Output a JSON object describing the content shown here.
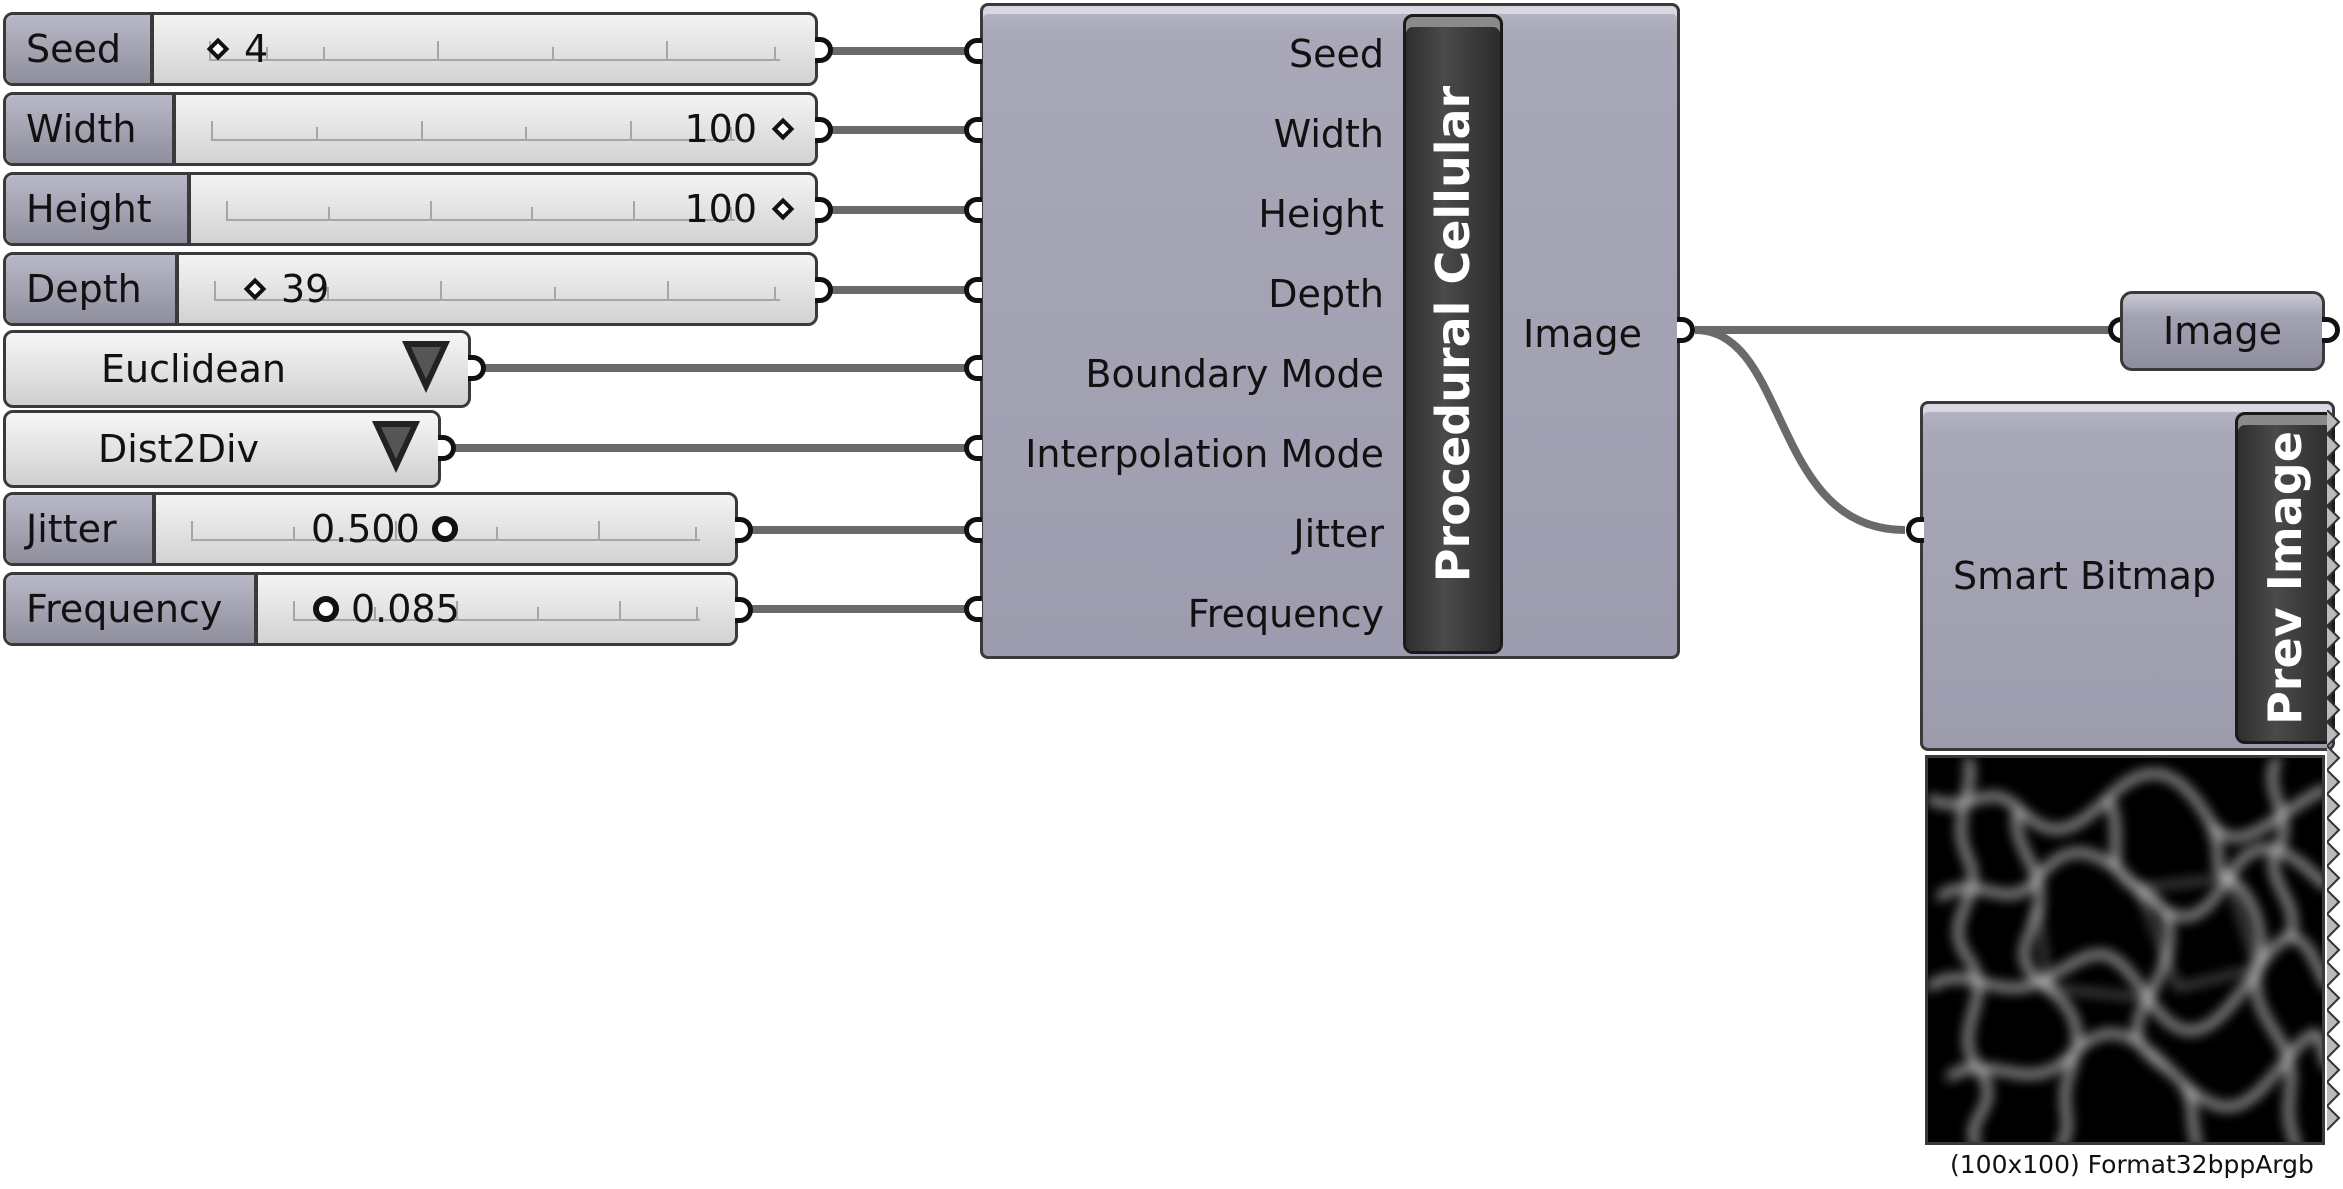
{
  "sliders": [
    {
      "label": "Seed",
      "value": "4"
    },
    {
      "label": "Width",
      "value": "100"
    },
    {
      "label": "Height",
      "value": "100"
    },
    {
      "label": "Depth",
      "value": "39"
    },
    {
      "label": "Jitter",
      "value": "0.500"
    },
    {
      "label": "Frequency",
      "value": "0.085"
    }
  ],
  "value_lists": [
    {
      "value": "Euclidean"
    },
    {
      "value": "Dist2Div"
    }
  ],
  "procedural_cellular": {
    "nickname": "Procedural Cellular",
    "inputs": [
      "Seed",
      "Width",
      "Height",
      "Depth",
      "Boundary Mode",
      "Interpolation Mode",
      "Jitter",
      "Frequency"
    ],
    "output": "Image"
  },
  "image_param": {
    "label": "Image"
  },
  "prev_image": {
    "nickname": "Prev Image",
    "input": "Smart Bitmap",
    "caption": "(100x100) Format32bppArgb"
  },
  "colors": {
    "wire": "#6a6a6a",
    "component_body": "#a8a8b8",
    "nickname_bar": "#3a3a3a"
  }
}
